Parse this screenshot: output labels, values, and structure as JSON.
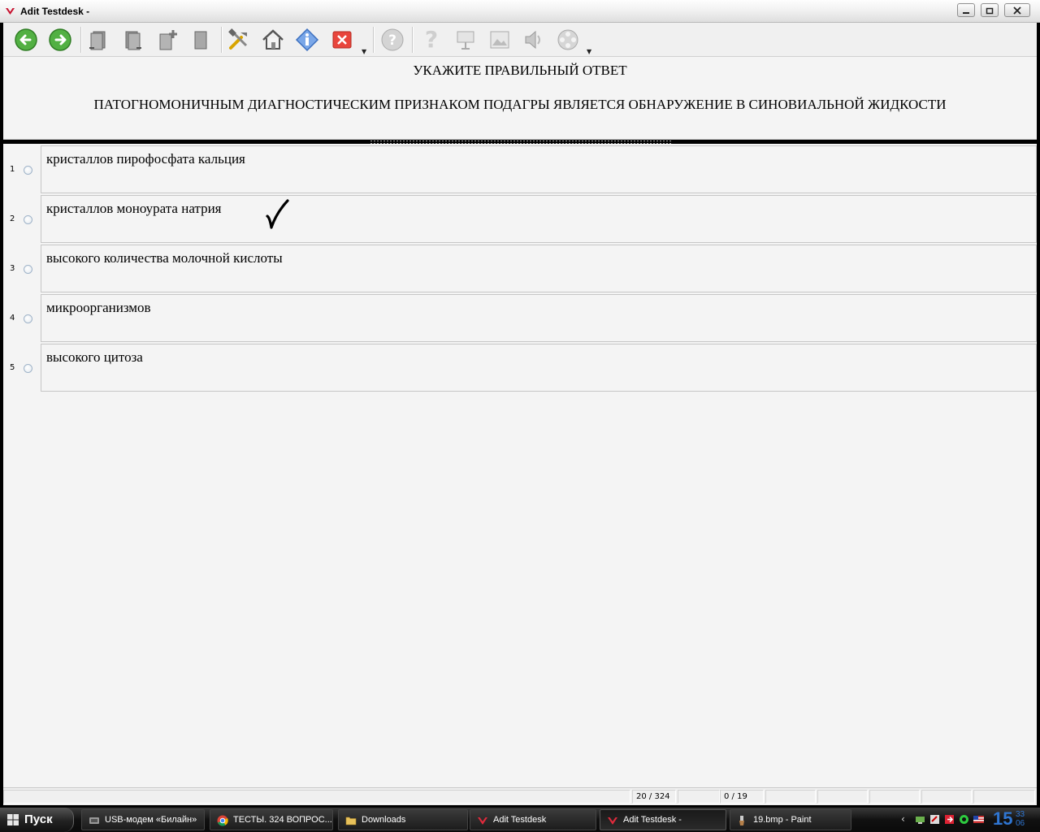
{
  "window": {
    "title": "Adit Testdesk -"
  },
  "toolbar": {
    "buttons": [
      "back-icon",
      "forward-icon",
      "prev-document-icon",
      "next-document-icon",
      "add-document-icon",
      "document-icon",
      "tools-icon",
      "home-icon",
      "info-icon",
      "close-icon",
      "help-icon",
      "hint-icon",
      "presentation-icon",
      "image-icon",
      "sound-icon",
      "video-icon"
    ]
  },
  "question": {
    "heading": "УКАЖИТЕ ПРАВИЛЬНЫЙ ОТВЕТ",
    "text": "ПАТОГНОМОНИЧНЫМ ДИАГНОСТИЧЕСКИМ ПРИЗНАКОМ ПОДАГРЫ ЯВЛЯЕТСЯ ОБНАРУЖЕНИЕ В СИНОВИАЛЬНОЙ ЖИДКОСТИ"
  },
  "answers": [
    {
      "num": "1",
      "text": "кристаллов пирофосфата кальция"
    },
    {
      "num": "2",
      "text": "кристаллов моноурата натрия"
    },
    {
      "num": "3",
      "text": "высокого количества молочной кислоты"
    },
    {
      "num": "4",
      "text": "микроорганизмов"
    },
    {
      "num": "5",
      "text": "высокого цитоза"
    }
  ],
  "status": {
    "question_counter": "20 / 324",
    "score": "0 / 19"
  },
  "taskbar": {
    "start_label": "Пуск",
    "tasks": [
      {
        "label": "USB-модем «Билайн»",
        "icon": "modem-icon"
      },
      {
        "label": "ТЕСТЫ. 324 ВОПРОС...",
        "icon": "chrome-icon"
      },
      {
        "label": "Downloads",
        "icon": "folder-icon"
      },
      {
        "label": "Adit Testdesk",
        "icon": "testdesk-icon"
      },
      {
        "label": "Adit Testdesk -",
        "icon": "testdesk-icon"
      },
      {
        "label": "19.bmp - Paint",
        "icon": "paint-icon"
      }
    ],
    "clock_hour": "15",
    "clock_min": "33",
    "clock_sec": "06"
  }
}
